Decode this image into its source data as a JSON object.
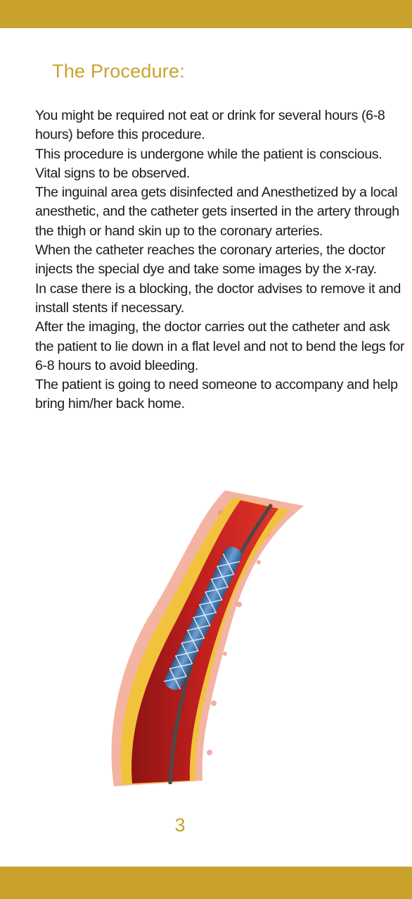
{
  "page": {
    "title": "The Procedure:",
    "paragraphs": [
      "You might be required not eat or drink for several hours (6-8 hours) before this procedure.",
      "This procedure is undergone while the patient is conscious.",
      "Vital signs to be observed.",
      "The inguinal area gets disinfected and Anesthetized by a local anesthetic, and the catheter gets inserted in the artery through the thigh or hand skin up to the coronary arteries.",
      "When the catheter reaches the coronary arteries, the doctor injects the special dye and take some images by the x-ray.",
      "In case there is a blocking, the doctor advises to remove it and install stents if necessary.",
      "After the imaging, the doctor carries out the catheter and ask the patient to lie down in a flat level and not to bend the legs for 6-8 hours to avoid bleeding.",
      "The patient is going to need someone to accompany and help bring him/her back home."
    ],
    "page_number": "3"
  },
  "colors": {
    "accent": "#c9a22d",
    "text": "#1a1a1a"
  }
}
